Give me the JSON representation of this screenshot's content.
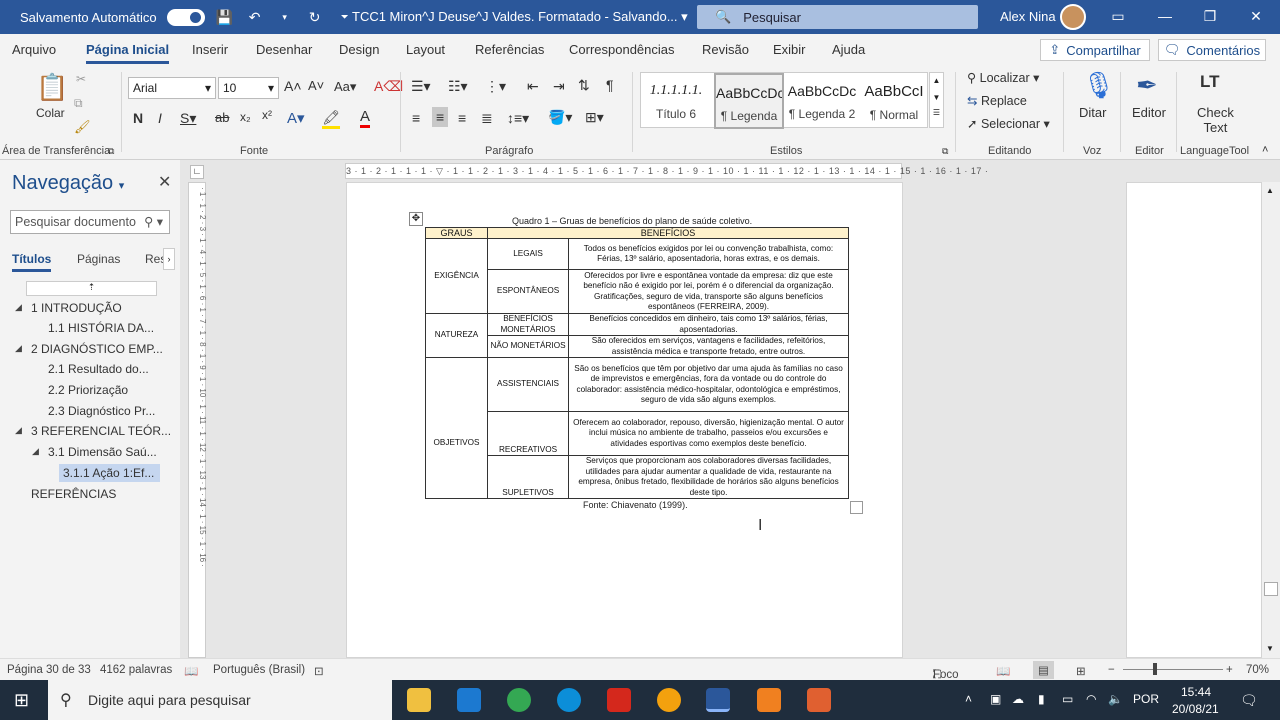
{
  "titlebar": {
    "autosave_label": "Salvamento Automático",
    "doc_title": "TCC1 Miron^J Deuse^J Valdes. Formatado - Salvando... ▾",
    "search_placeholder": "Pesquisar",
    "user": "Alex Nina"
  },
  "menu": {
    "tabs": [
      "Arquivo",
      "Página Inicial",
      "Inserir",
      "Desenhar",
      "Design",
      "Layout",
      "Referências",
      "Correspondências",
      "Revisão",
      "Exibir",
      "Ajuda"
    ],
    "share": "Compartilhar",
    "comments": "Comentários"
  },
  "ribbon": {
    "clipboard": {
      "paste": "Colar",
      "label": "Área de Transferência"
    },
    "font": {
      "name": "Arial",
      "size": "10",
      "label": "Fonte"
    },
    "paragraph": {
      "label": "Parágrafo"
    },
    "styles": {
      "label": "Estilos",
      "items": [
        {
          "preview": "1.1.1.1.1.",
          "name": "Título 6"
        },
        {
          "preview": "AaBbCcDc",
          "name": "¶ Legenda"
        },
        {
          "preview": "AaBbCcDc",
          "name": "¶ Legenda 2"
        },
        {
          "preview": "AaBbCcI",
          "name": "¶ Normal"
        }
      ]
    },
    "editing": {
      "find": "Localizar",
      "replace": "Replace",
      "select": "Selecionar",
      "label": "Editando"
    },
    "voice": {
      "dictate": "Ditar",
      "label": "Voz"
    },
    "editor": {
      "editor": "Editor",
      "label": "Editor"
    },
    "languagetool": {
      "check": "Check",
      "text": "Text",
      "label": "LanguageTool"
    }
  },
  "nav": {
    "title": "Navegação",
    "search_placeholder": "Pesquisar documento",
    "tabs": [
      "Títulos",
      "Páginas",
      "Res"
    ],
    "items": [
      {
        "label": "1 INTRODUÇÃO"
      },
      {
        "label": "1.1 HISTÓRIA DA..."
      },
      {
        "label": "2 DIAGNÓSTICO EMP..."
      },
      {
        "label": "2.1 Resultado do..."
      },
      {
        "label": "2.2 Priorização"
      },
      {
        "label": "2.3 Diagnóstico Pr..."
      },
      {
        "label": "3 REFERENCIAL TEÓR..."
      },
      {
        "label": "3.1 Dimensão Saú..."
      },
      {
        "label": "3.1.1 Ação 1:Ef..."
      },
      {
        "label": "REFERÊNCIAS"
      }
    ]
  },
  "document": {
    "caption": "Quadro 1 – Gruas de benefícios do plano de saúde coletivo.",
    "table_headers": [
      "GRAUS",
      "BENEFÍCIOS"
    ],
    "groups": {
      "exigencia": "EXIGÊNCIA",
      "natureza": "NATUREZA",
      "objetivos": "OBJETIVOS"
    },
    "rows": [
      {
        "type": "LEGAIS",
        "desc": "Todos os benefícios exigidos por lei ou convenção trabalhista, como: Férias, 13º salário, aposentadoria, horas extras, e os demais."
      },
      {
        "type": "ESPONTÂNEOS",
        "desc": "Oferecidos por livre e espontânea vontade da empresa: diz que este benefício não é exigido por lei, porém é o diferencial da organização. Gratificações, seguro de vida, transporte são alguns benefícios espontâneos (FERREIRA, 2009)."
      },
      {
        "type": "BENEFÍCIOS MONETÁRIOS",
        "desc": "Benefícios concedidos em dinheiro, tais como 13º salários, férias, aposentadorias."
      },
      {
        "type": "NÃO MONETÁRIOS",
        "desc": "São oferecidos em serviços, vantagens e facilidades, refeitórios, assistência médica e transporte fretado, entre outros."
      },
      {
        "type": "ASSISTENCIAIS",
        "desc": "São os benefícios que têm por objetivo dar uma ajuda às famílias no caso de imprevistos e emergências, fora da vontade ou do controle do colaborador: assistência médico-hospitalar, odontológica e empréstimos, seguro de vida são alguns exemplos."
      },
      {
        "type": "RECREATIVOS",
        "desc": "Oferecem ao colaborador, repouso, diversão, higienização mental. O autor inclui música no ambiente de trabalho, passeios e/ou excursões e atividades esportivas como exemplos deste benefício."
      },
      {
        "type": "SUPLETIVOS",
        "desc": "Serviços que proporcionam aos colaboradores diversas facilidades, utilidades para ajudar aumentar a qualidade de vida, restaurante na empresa, ônibus fretado, flexibilidade de horários são alguns benefícios deste tipo."
      }
    ],
    "source": "Fonte: Chiavenato (1999)."
  },
  "status": {
    "page": "Página 30 de 33",
    "words": "4162 palavras",
    "language": "Português (Brasil)",
    "focus": "Foco",
    "zoom": "70%"
  },
  "taskbar": {
    "search_placeholder": "Digite aqui para pesquisar",
    "lang": "POR",
    "time": "15:44",
    "date": "20/08/21"
  }
}
